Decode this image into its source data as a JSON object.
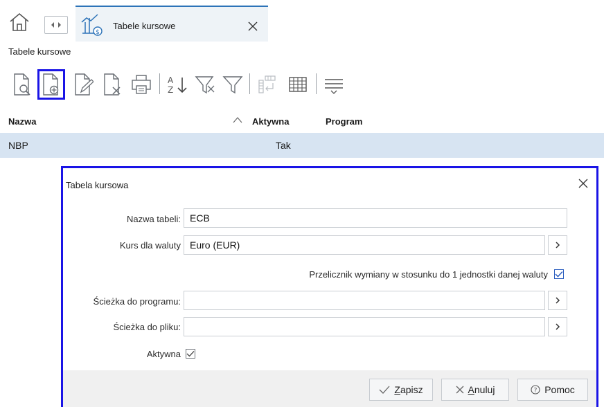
{
  "tabbar": {
    "home_icon": "home-icon",
    "nav_icon": "tab-switch-icon",
    "tab_label": "Tabele kursowe",
    "tab_icon": "exchange-rate-chart-icon",
    "close_icon": "close-icon"
  },
  "page": {
    "title": "Tabele kursowe"
  },
  "toolbar": {
    "items": [
      "view-icon",
      "add-icon",
      "edit-icon",
      "delete-icon",
      "print-icon",
      "sort-az-icon",
      "filter-clear-icon",
      "filter-icon",
      "columns-icon",
      "grid-icon",
      "menu-icon"
    ],
    "accent": "#1a14e6"
  },
  "grid": {
    "columns": [
      "Nazwa",
      "Aktywna",
      "Program"
    ],
    "rows": [
      {
        "nazwa": "NBP",
        "aktywna": "Tak",
        "program": ""
      }
    ],
    "selected_row_color": "#d7e4f2"
  },
  "dialog": {
    "title": "Tabela kursowa",
    "fields": {
      "nazwa_label": "Nazwa tabeli:",
      "nazwa_value": "ECB",
      "kurs_label": "Kurs dla waluty",
      "kurs_value": "Euro (EUR)",
      "przelicznik_label": "Przelicznik wymiany w stosunku do 1 jednostki danej waluty",
      "przelicznik_checked": true,
      "sciezka_prog_label": "Ścieżka do programu:",
      "sciezka_prog_value": "",
      "sciezka_plik_label": "Ścieżka do pliku:",
      "sciezka_plik_value": "",
      "aktywna_label": "Aktywna",
      "aktywna_checked": true
    },
    "buttons": {
      "save_first": "Z",
      "save_rest": "apisz",
      "cancel_first": "A",
      "cancel_rest": "nuluj",
      "help": "Pomoc"
    }
  }
}
